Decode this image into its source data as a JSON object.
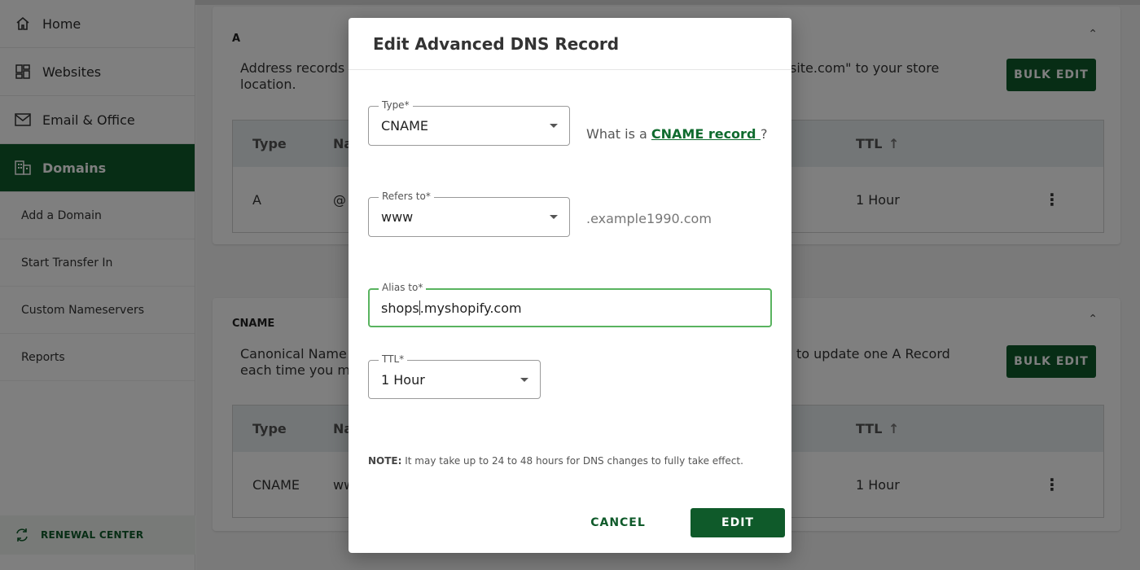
{
  "sidebar": {
    "nav": [
      {
        "label": "Home",
        "icon": "home-icon"
      },
      {
        "label": "Websites",
        "icon": "websites-icon"
      },
      {
        "label": "Email & Office",
        "icon": "mail-icon"
      },
      {
        "label": "Domains",
        "icon": "domains-icon",
        "active": true
      }
    ],
    "sub": [
      "Add a Domain",
      "Start Transfer In",
      "Custom Nameservers",
      "Reports"
    ],
    "renewal_label": "RENEWAL CENTER"
  },
  "a_section": {
    "title": "A",
    "desc_left": "Address records c",
    "desc_left_line2": "location.",
    "desc_right": "site.com\" to your store",
    "bulk_label": "BULK EDIT",
    "columns": {
      "type": "Type",
      "name": "Na",
      "ttl": "TTL"
    },
    "row": {
      "type": "A",
      "name": "@",
      "ttl": "1 Hour"
    }
  },
  "cname_section": {
    "title": "CNAME",
    "desc_left": "Canonical Name p",
    "desc_left_line2": "each time you ma",
    "desc_right": "to update one A Record",
    "bulk_label": "BULK EDIT",
    "columns": {
      "type": "Type",
      "name": "Na",
      "ttl": "TTL"
    },
    "row": {
      "type": "CNAME",
      "name": "ww",
      "ttl": "1 Hour"
    }
  },
  "modal": {
    "title": "Edit Advanced DNS Record",
    "type": {
      "label": "Type*",
      "value": "CNAME",
      "hint_prefix": "What is a ",
      "hint_link": "CNAME record ",
      "hint_suffix": "?"
    },
    "refers_to": {
      "label": "Refers to*",
      "value": "www",
      "suffix": ".example1990.com"
    },
    "alias_to": {
      "label": "Alias to*",
      "value_before_cursor": "shops",
      "value_after_cursor": ".myshopify.com"
    },
    "ttl": {
      "label": "TTL*",
      "value": "1 Hour"
    },
    "note_bold": "NOTE:",
    "note_text": " It may take up to 24 to 48 hours for DNS changes to fully take effect.",
    "cancel_label": "CANCEL",
    "edit_label": "EDIT"
  },
  "colors": {
    "brand_green": "#0f5a2a",
    "focus_green": "#59b35f"
  }
}
